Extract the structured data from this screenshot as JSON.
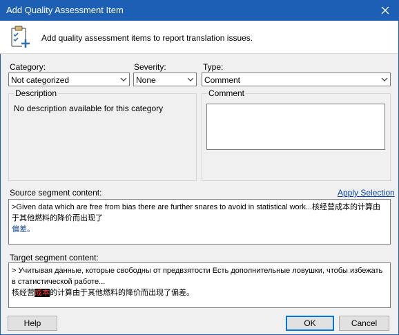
{
  "window": {
    "title": "Add Quality Assessment Item",
    "close_glyph": "✕"
  },
  "header": {
    "text": "Add quality assessment items to report translation issues.",
    "icon": "clipboard-add-icon"
  },
  "category": {
    "label": "Category:",
    "value": "Not categorized"
  },
  "severity": {
    "label": "Severity:",
    "value": "None"
  },
  "type": {
    "label": "Type:",
    "value": "Comment"
  },
  "description": {
    "title": "Description",
    "text": "No description available for this category"
  },
  "comment": {
    "title": "Comment",
    "value": ""
  },
  "source": {
    "label": "Source segment content:",
    "apply_label": "Apply Selection",
    "line1": ">Given data which are free from bias there are further snares to avoid in statistical work...核经营成本的计算由于其他燃料的降价而出现了",
    "line2": "偏差。"
  },
  "target": {
    "label": "Target segment content:",
    "line1": "> Учитывая данные, которые свободны от предвзятости Есть дополнительные ловушки, чтобы избежать в статистической работе...",
    "line2_before": "核经营",
    "line2_highlight": "成本",
    "line2_after": "的计算由于其他燃料的降价而出现了偏差。"
  },
  "buttons": {
    "help": "Help",
    "ok": "OK",
    "cancel": "Cancel"
  },
  "colors": {
    "titlebar": "#1d5fb4",
    "link": "#0645ad",
    "highlight_bg": "#000000",
    "highlight_fg": "#ff3b3b"
  }
}
